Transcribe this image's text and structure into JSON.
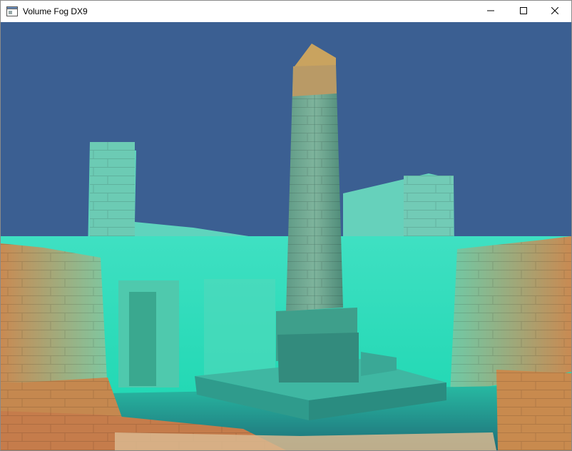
{
  "window": {
    "title": "Volume Fog DX9"
  },
  "controls": {
    "minimize_icon": "minimize-icon",
    "maximize_icon": "maximize-icon",
    "close_icon": "close-icon"
  },
  "scene": {
    "sky_color": "#3b5f92",
    "fog_color": "#2ee6c0",
    "sandstone_color": "#c98a52"
  }
}
